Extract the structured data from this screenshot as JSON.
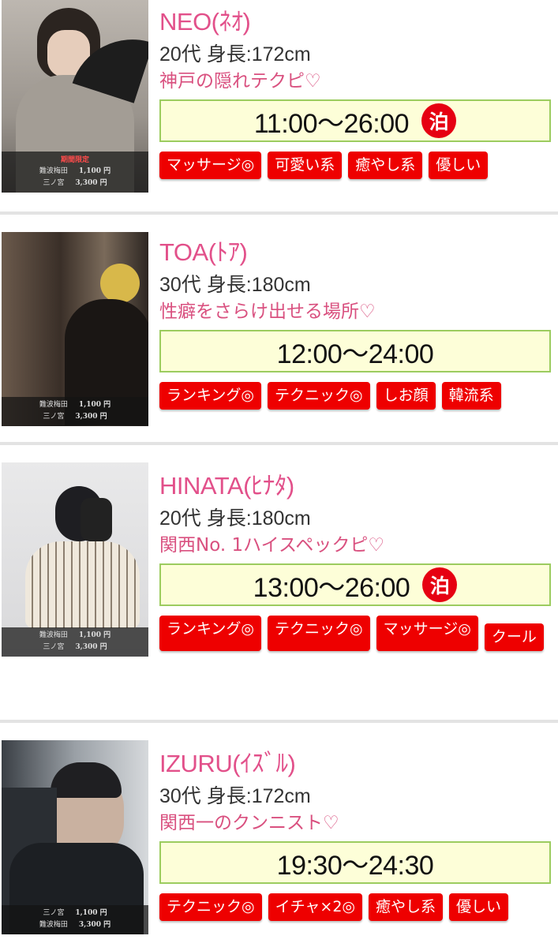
{
  "stay_icon_label": "泊",
  "cards": [
    {
      "name": "NEO(ﾈｵ)",
      "spec": "20代 身長:172cm",
      "catch": "神戸の隠れテクピ♡",
      "time": "11:00〜26:00",
      "overnight": true,
      "tags": [
        "マッサージ◎",
        "可愛い系",
        "癒やし系",
        "優しい"
      ],
      "price_special": "期間限定",
      "prices": [
        {
          "area": "難波梅田",
          "price": "1,100 円"
        },
        {
          "area": "三ノ宮",
          "price": "3,300 円"
        }
      ]
    },
    {
      "name": "TOA(ﾄｱ)",
      "spec": "30代 身長:180cm",
      "catch": "性癖をさらけ出せる場所♡",
      "time": "12:00〜24:00",
      "overnight": false,
      "tags": [
        "ランキング◎",
        "テクニック◎",
        "しお顔",
        "韓流系"
      ],
      "price_special": "",
      "prices": [
        {
          "area": "難波梅田",
          "price": "1,100 円"
        },
        {
          "area": "三ノ宮",
          "price": "3,300 円"
        }
      ]
    },
    {
      "name": "HINATA(ﾋﾅﾀ)",
      "spec": "20代 身長:180cm",
      "catch": "関西No. 1ハイスペックピ♡",
      "time": "13:00〜26:00",
      "overnight": true,
      "tags": [
        "ランキング◎",
        "テクニック◎",
        "マッサージ◎",
        "クール"
      ],
      "price_special": "",
      "prices": [
        {
          "area": "難波梅田",
          "price": "1,100 円"
        },
        {
          "area": "三ノ宮",
          "price": "3,300 円"
        }
      ]
    },
    {
      "name": "IZURU(ｲｽﾞﾙ)",
      "spec": "30代 身長:172cm",
      "catch": "関西一のクンニスト♡",
      "time": "19:30〜24:30",
      "overnight": false,
      "tags": [
        "テクニック◎",
        "イチャ×2◎",
        "癒やし系",
        "優しい"
      ],
      "price_special": "",
      "prices": [
        {
          "area": "三ノ宮",
          "price": "1,100 円"
        },
        {
          "area": "難波梅田",
          "price": "3,300 円"
        }
      ]
    }
  ]
}
